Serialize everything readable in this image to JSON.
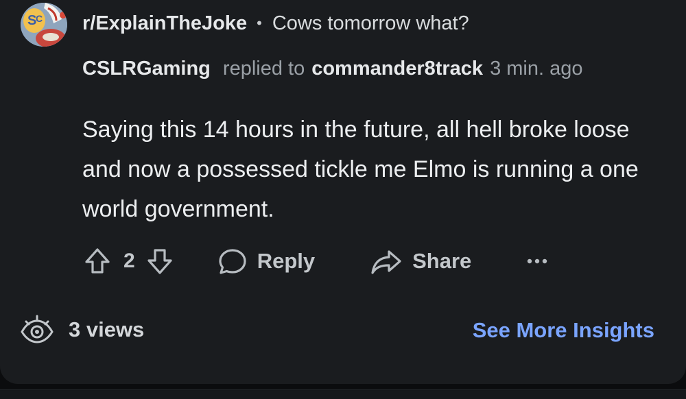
{
  "header": {
    "subreddit": "r/ExplainTheJoke",
    "separator": "•",
    "post_title": "Cows tomorrow what?"
  },
  "comment": {
    "author": "CSLRGaming",
    "replied_to_text": "replied to",
    "parent_author": "commander8track",
    "timestamp": "3 min. ago",
    "body": "Saying this 14 hours in the future, all hell broke loose and now a possessed tickle me Elmo is running a one world government."
  },
  "actions": {
    "vote_count": "2",
    "reply_label": "Reply",
    "share_label": "Share",
    "more_label": "•••",
    "icons": [
      "upvote-icon",
      "downvote-icon",
      "chat-bubble-icon",
      "share-arrow-icon",
      "more-icon"
    ]
  },
  "insights": {
    "views_label": "3 views",
    "see_more_label": "See More Insights",
    "icon": "eye-icon"
  },
  "colors": {
    "background": "#1a1c1f",
    "link_blue": "#7aa4ff",
    "muted_text": "#9aa0a6"
  }
}
